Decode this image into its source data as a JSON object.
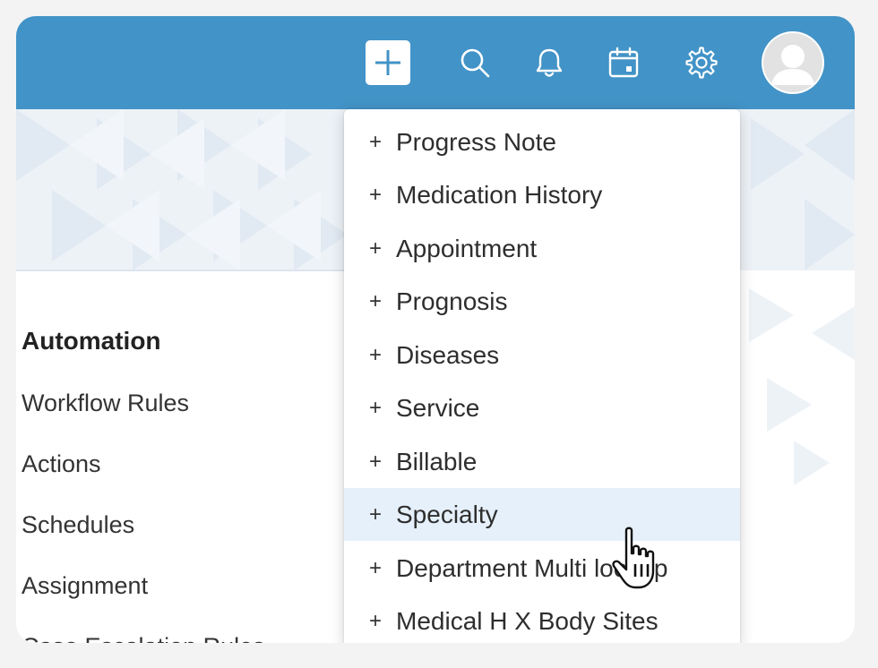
{
  "topbar": {
    "background": "#4293c7",
    "icons": [
      "plus-icon",
      "search-icon",
      "bell-icon",
      "calendar-icon",
      "gear-icon",
      "avatar"
    ]
  },
  "sidebar": {
    "heading": "Automation",
    "items": [
      {
        "label": "Workflow Rules"
      },
      {
        "label": "Actions"
      },
      {
        "label": "Schedules"
      },
      {
        "label": "Assignment"
      },
      {
        "label": "Case Escalation Rules"
      }
    ]
  },
  "dropdown": {
    "plus_glyph": "+",
    "items": [
      {
        "label": "Progress Note"
      },
      {
        "label": "Medication History"
      },
      {
        "label": "Appointment"
      },
      {
        "label": "Prognosis"
      },
      {
        "label": "Diseases"
      },
      {
        "label": "Service"
      },
      {
        "label": "Billable"
      },
      {
        "label": "Specialty",
        "hovered": true
      },
      {
        "label": "Department Multi lookup"
      },
      {
        "label": "Medical H X Body Sites"
      }
    ],
    "hover_color": "#e6f0fb"
  }
}
